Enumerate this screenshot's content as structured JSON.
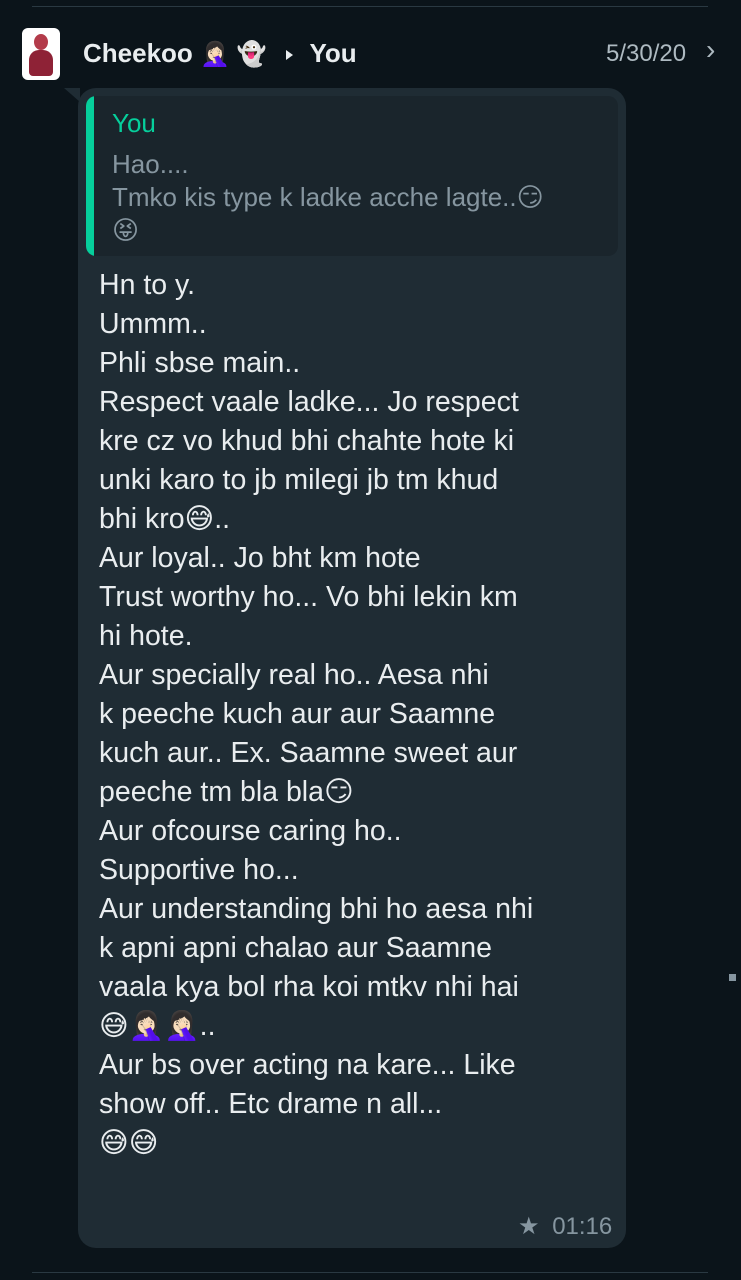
{
  "header": {
    "avatar_icon": "profile-photo",
    "sender_name": "Cheekoo",
    "sender_emojis": "🤦🏻‍♀️ 👻",
    "recipient": "You",
    "date": "5/30/20",
    "chevron": "›"
  },
  "quote": {
    "author": "You",
    "lines": [
      "Hao....",
      "Tmko kis type k ladke acche lagte..😏",
      "😝"
    ]
  },
  "message": {
    "lines": [
      "Hn to y.",
      "Ummm..",
      "Phli sbse main..",
      "Respect vaale ladke... Jo respect",
      "kre cz vo khud bhi chahte hote ki",
      "unki karo to jb milegi jb tm khud",
      "bhi kro😅..",
      "Aur loyal.. Jo bht km hote",
      "Trust worthy ho...  Vo bhi lekin km",
      "hi hote.",
      "Aur specially real ho.. Aesa nhi",
      "k peeche kuch aur aur Saamne",
      "kuch aur..  Ex. Saamne sweet aur",
      "peeche tm bla bla😏",
      "Aur ofcourse caring ho..",
      "Supportive ho...",
      "Aur understanding bhi ho aesa nhi",
      "k apni apni chalao aur Saamne",
      "vaala kya bol rha koi mtkv nhi hai",
      "😅🤦🏻‍♀️🤦🏻‍♀️..",
      "Aur bs over acting na kare... Like",
      "show off.. Etc drame n all...",
      "😅😅"
    ]
  },
  "footer": {
    "star_icon": "★",
    "time": "01:16"
  },
  "colors": {
    "background": "#0b141a",
    "bubble": "#1f2c34",
    "quote_accent": "#06cf9c",
    "text_primary": "#e9edef",
    "text_secondary": "#8696a0"
  }
}
